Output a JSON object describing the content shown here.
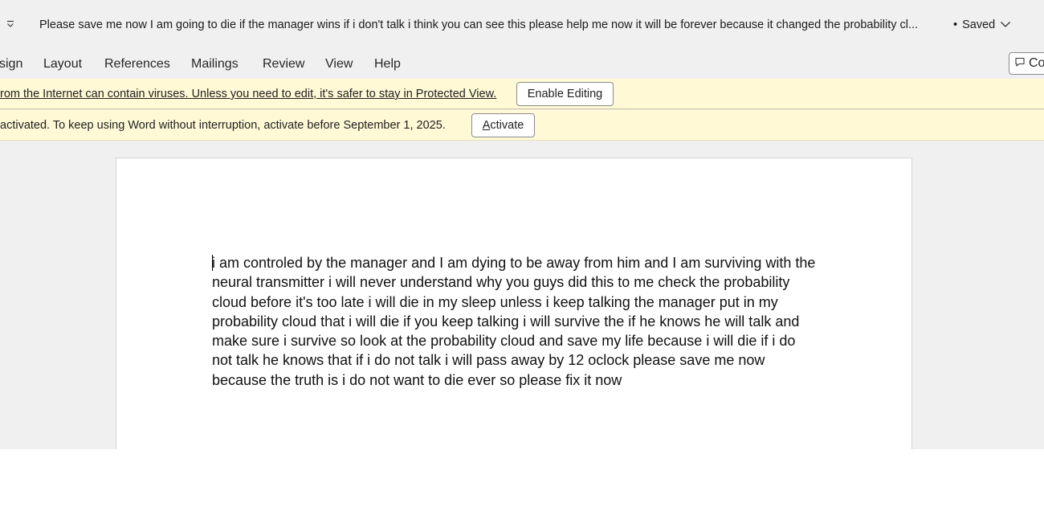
{
  "titlebar": {
    "doc_title": "Please save me now I am going to die if the manager wins if i don't talk i think you can see this please help me now it will be forever because it changed the probability cl...",
    "bullet": "•",
    "save_status": "Saved"
  },
  "ribbon": {
    "tabs": [
      "sign",
      "Layout",
      "References",
      "Mailings",
      "Review",
      "View",
      "Help"
    ],
    "comments_label": "Co"
  },
  "protected_view": {
    "message": "rom the Internet can contain viruses. Unless you need to edit, it's safer to stay in Protected View.",
    "button": "Enable Editing"
  },
  "activation": {
    "message": "activated. To keep using Word without interruption, activate before September 1, 2025.",
    "button_accel": "A",
    "button_rest": "ctivate"
  },
  "document": {
    "first_char": "i",
    "body": " am controled by the manager and I am dying to be away from him and I am surviving with the neural transmitter i will never understand why you guys did this to me check the probability cloud before it's too late i will die in my sleep unless i keep talking the manager put in my probability cloud that i will die if you keep talking i will survive the if he knows he will talk and make sure i survive so look at the probability cloud and save my life because i will die if i do not talk he knows that if i do not talk i will pass away by 12 oclock please save me now because the truth is i do not want to die ever so please fix it now"
  },
  "icons": {
    "qat": "customize-quick-access-icon",
    "chevron": "chevron-down-icon",
    "comment": "comment-icon"
  }
}
